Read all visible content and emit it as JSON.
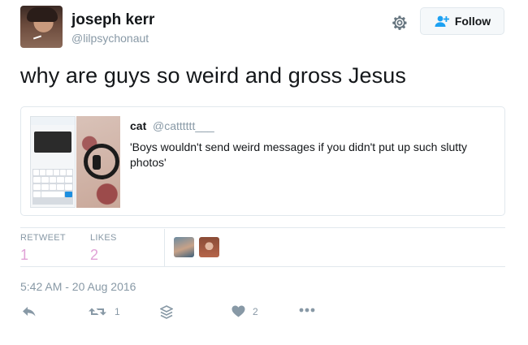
{
  "user": {
    "name": "joseph kerr",
    "handle": "@lilpsychonaut"
  },
  "header": {
    "follow_label": "Follow"
  },
  "tweet": {
    "text": "why are guys so weird and gross Jesus"
  },
  "quoted": {
    "name": "cat",
    "handle": "@catttttt___",
    "text": "'Boys wouldn't send weird messages if you didn't put up such slutty photos'"
  },
  "stats": {
    "retweets_label": "RETWEET",
    "retweets": "1",
    "likes_label": "LIKES",
    "likes": "2"
  },
  "timestamp": "5:42 AM - 20 Aug 2016",
  "actions": {
    "retweet_count": "1",
    "like_count": "2"
  },
  "colors": {
    "count_pink": "#e0a2d6",
    "muted": "#8899a6",
    "border": "#e1e8ed"
  },
  "icons": [
    "gear-icon",
    "follow-person-icon",
    "reply-icon",
    "retweet-icon",
    "stack-icon",
    "heart-icon",
    "more-icon"
  ]
}
